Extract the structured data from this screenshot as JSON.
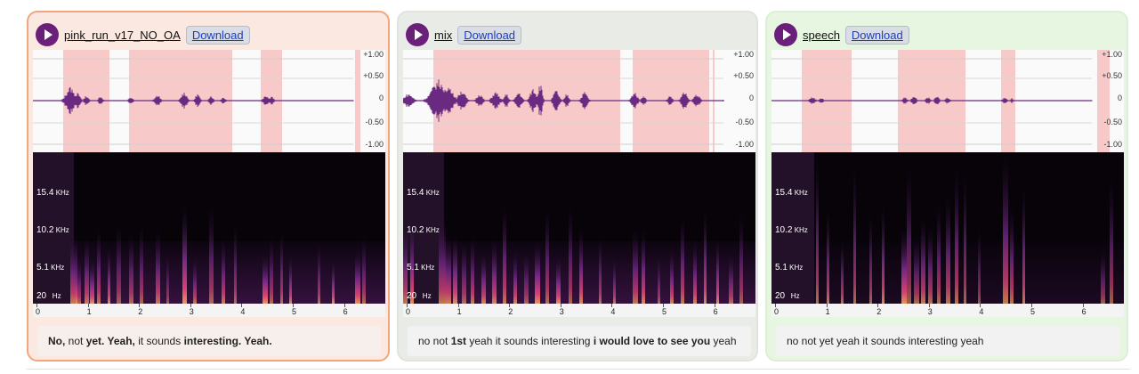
{
  "download_label": "Download",
  "yaxis_labels": [
    "+1.00",
    "+0.50",
    "0",
    "-0.50",
    "-1.00"
  ],
  "freq_labels": [
    {
      "value": "15.4",
      "unit": "KHz"
    },
    {
      "value": "10.2",
      "unit": "KHz"
    },
    {
      "value": "5.1",
      "unit": "KHz"
    },
    {
      "value": "20",
      "unit": "Hz"
    }
  ],
  "time_ticks": [
    "0",
    "1",
    "2",
    "3",
    "4",
    "5",
    "6"
  ],
  "colors": {
    "play": "#6a1f7a",
    "waveform": "#6b2a82",
    "highlight": "#f8c9c9"
  },
  "cards": [
    {
      "name": "pink_run_v17_NO_OA",
      "transcript": [
        {
          "text": "No,",
          "bold": true
        },
        {
          "text": " not ",
          "bold": false
        },
        {
          "text": "yet. Yeah,",
          "bold": true
        },
        {
          "text": " it sounds ",
          "bold": false
        },
        {
          "text": "interesting. Yeah.",
          "bold": true
        }
      ]
    },
    {
      "name": "mix",
      "transcript": [
        {
          "text": "no not ",
          "bold": false
        },
        {
          "text": "1st",
          "bold": true
        },
        {
          "text": " yeah it sounds interesting ",
          "bold": false
        },
        {
          "text": "i would love to see you",
          "bold": true
        },
        {
          "text": " yeah",
          "bold": false
        }
      ]
    },
    {
      "name": "speech",
      "transcript": [
        {
          "text": "no not yet yeah it sounds interesting yeah",
          "bold": false
        }
      ]
    }
  ]
}
